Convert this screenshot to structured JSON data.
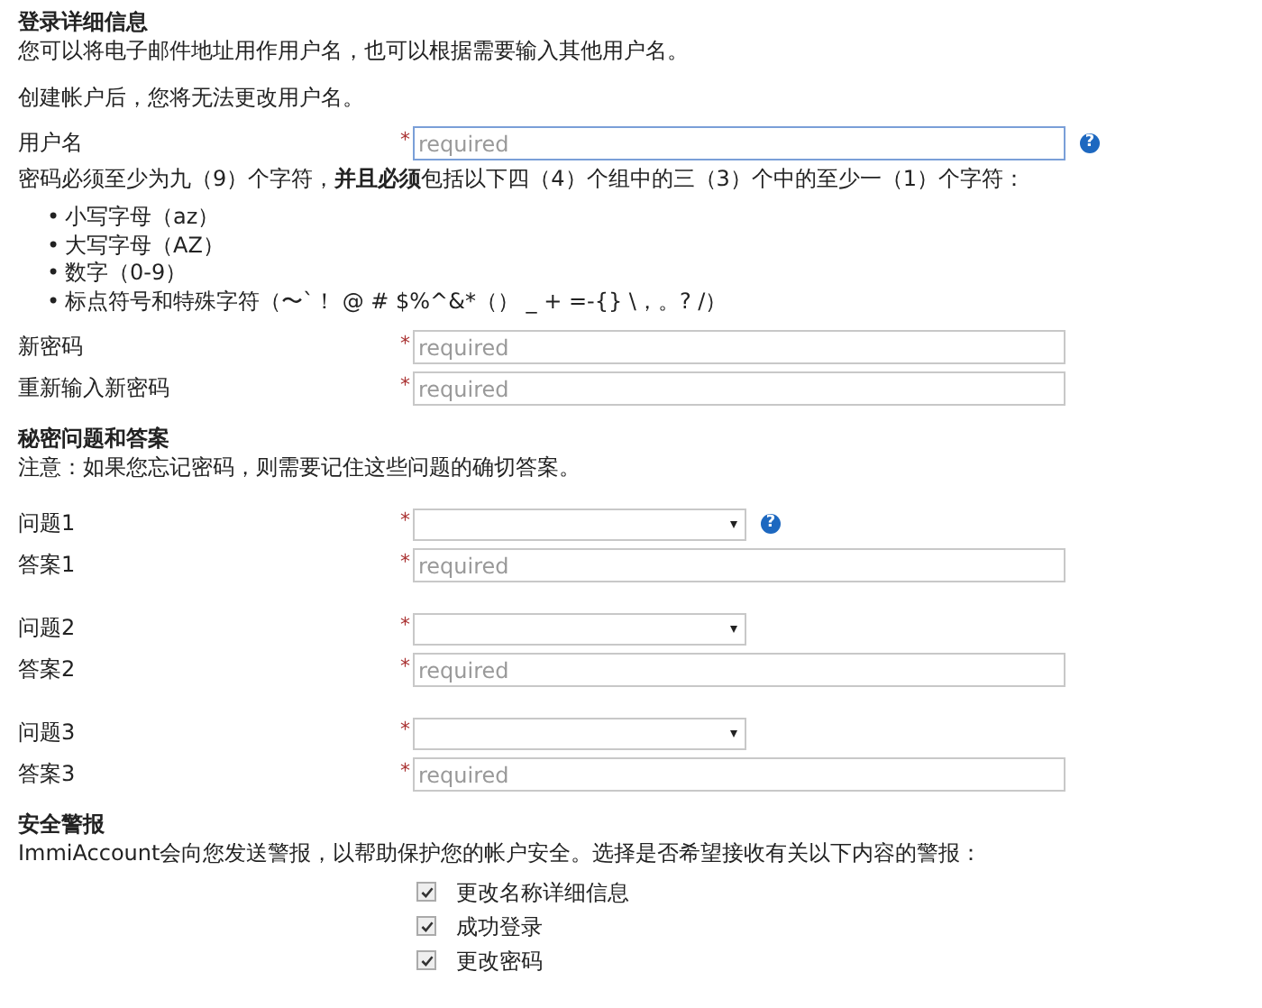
{
  "login": {
    "title": "登录详细信息",
    "notes": [
      "您可以将电子邮件地址用作用户名，也可以根据需要输入其他用户名。",
      "创建帐户后，您将无法更改用户名。"
    ],
    "username": {
      "label": "用户名",
      "mark": "*",
      "placeholder": "required",
      "help": "?"
    },
    "password_rule": "密码必须至少为九（9）个字符，**并且必须**包括以下四（4）个组中的三（3）个中的至少一（1）个字符：",
    "bullet": "•",
    "rules": [
      "小写字母（az）",
      "大写字母（AZ）",
      "数字（0-9）",
      "标点符号和特殊字符（〜`！ @ # $%^&*（） _ + =-{} \\，。? /）"
    ],
    "fields": [
      {
        "label": "新密码",
        "mark": "*",
        "placeholder": "required"
      },
      {
        "label": "重新输入新密码",
        "mark": "*",
        "placeholder": "required"
      }
    ]
  },
  "secret": {
    "title": "秘密问题和答案",
    "note": "注意：如果您忘记密码，则需要记住这些问题的确切答案。",
    "questions": [
      {
        "question_label": "问题1",
        "question_mark": "*",
        "help": "?",
        "answer_label": "答案1",
        "answer_mark": "*",
        "answer_placeholder": "required"
      },
      {
        "question_label": "问题2",
        "question_mark": "*",
        "answer_label": "答案2",
        "answer_mark": "*",
        "answer_placeholder": "required"
      },
      {
        "question_label": "问题3",
        "question_mark": "*",
        "answer_label": "答案3",
        "answer_mark": "*",
        "answer_placeholder": "required"
      }
    ]
  },
  "alerts": {
    "title": "安全警报",
    "text": "ImmiAccount会向您发送警报，以帮助保护您的帐户安全。选择是否希望接收有关以下内容的警报：",
    "options": [
      {
        "label": "更改名称详细信息",
        "checked": true
      },
      {
        "label": "成功登录",
        "checked": true
      },
      {
        "label": "更改密码",
        "checked": true
      }
    ]
  }
}
